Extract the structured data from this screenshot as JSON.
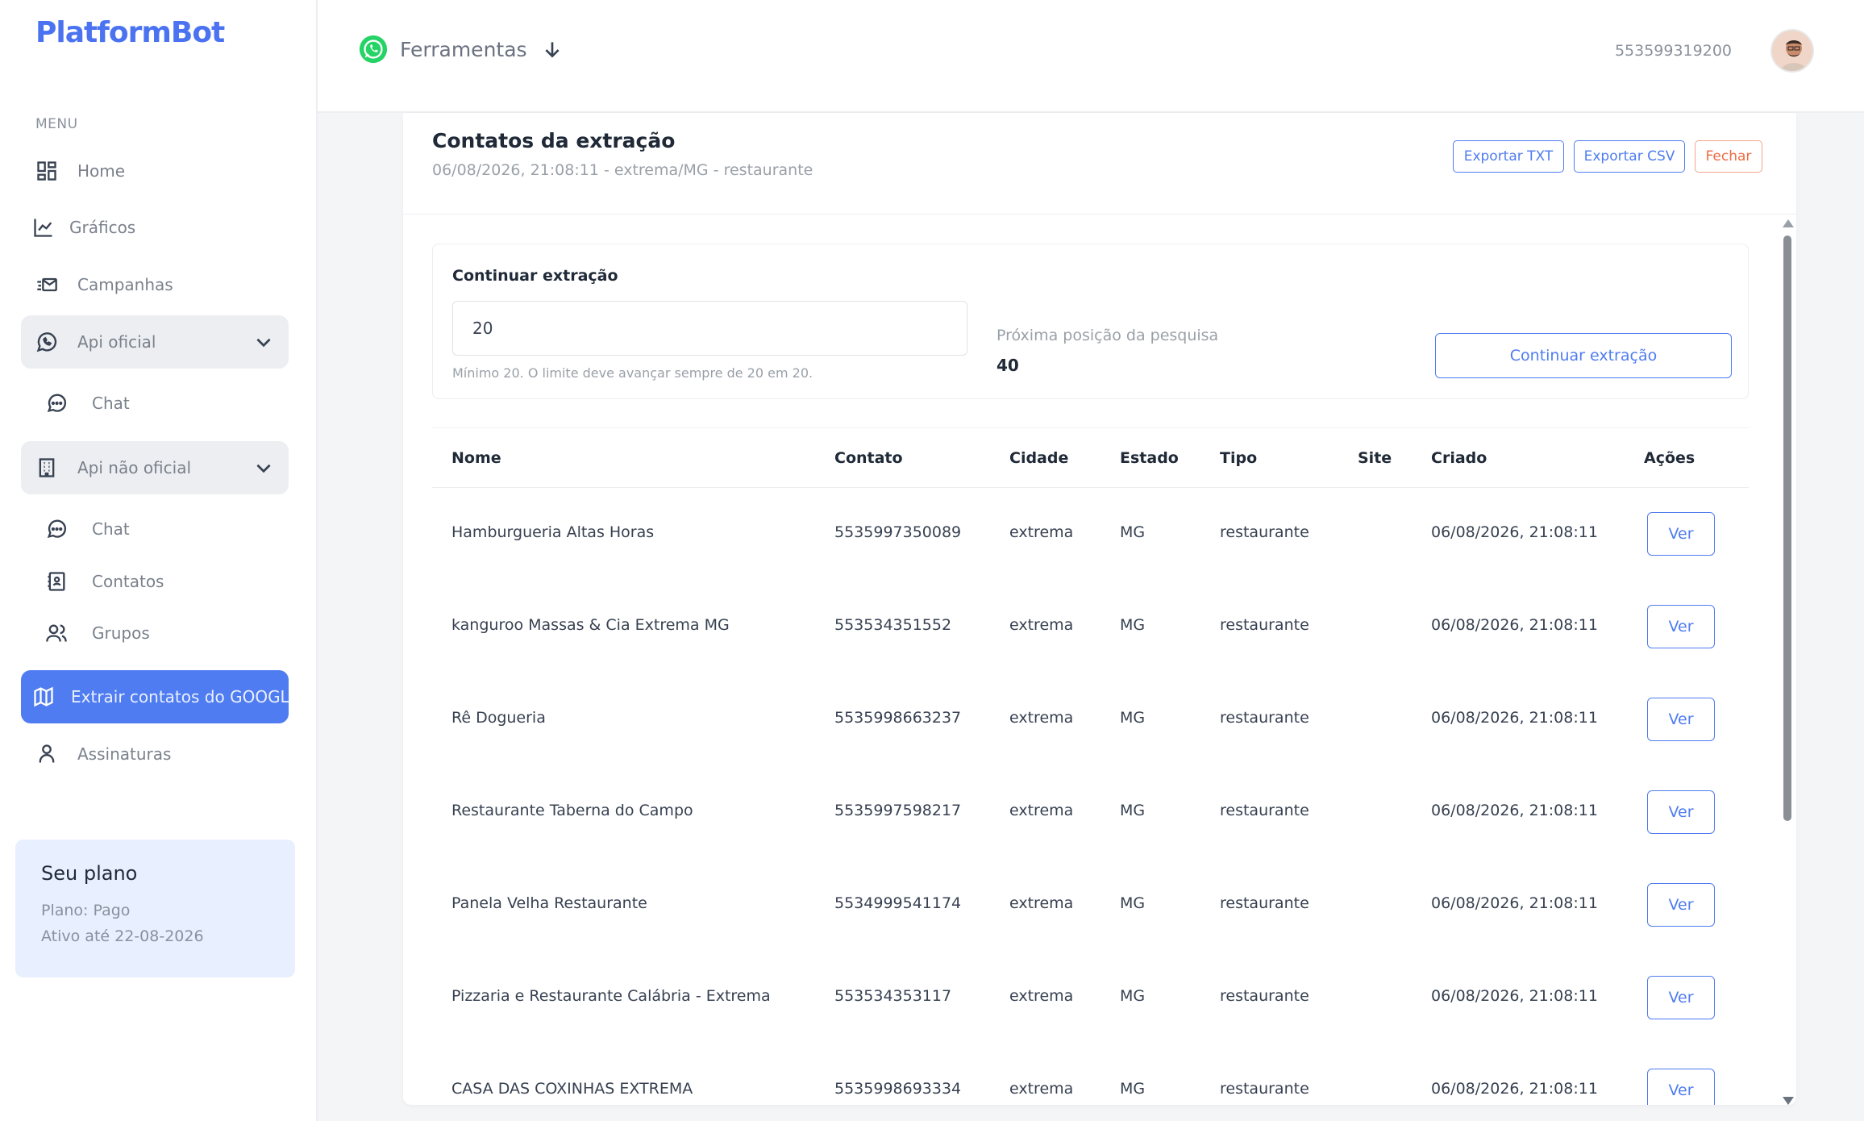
{
  "app": {
    "logo": "PlatformBot"
  },
  "sidebar": {
    "menu_label": "MENU",
    "items": [
      {
        "label": "Home",
        "icon": "dashboard-icon"
      },
      {
        "label": "Gráficos",
        "icon": "chart-icon"
      },
      {
        "label": "Campanhas",
        "icon": "campaign-mail-icon"
      },
      {
        "label": "Api oficial",
        "icon": "whatsapp-icon"
      },
      {
        "label": "Chat",
        "icon": "chat-bubble-icon"
      },
      {
        "label": "Api não oficial",
        "icon": "building-icon"
      },
      {
        "label": "Chat",
        "icon": "chat-bubble-icon"
      },
      {
        "label": "Contatos",
        "icon": "contacts-book-icon"
      },
      {
        "label": "Grupos",
        "icon": "users-icon"
      },
      {
        "label": "Extrair contatos do GOOGLE",
        "icon": "map-icon"
      },
      {
        "label": "Assinaturas",
        "icon": "user-icon"
      }
    ],
    "plan": {
      "title": "Seu plano",
      "plan_line": "Plano: Pago",
      "active_line": "Ativo até 22-08-2026"
    }
  },
  "topbar": {
    "tools_label": "Ferramentas",
    "phone": "553599319200"
  },
  "card": {
    "title": "Contatos da extração",
    "subtitle": "06/08/2026, 21:08:11 - extrema/MG - restaurante",
    "export_txt": "Exportar TXT",
    "export_csv": "Exportar CSV",
    "close": "Fechar"
  },
  "continue": {
    "label": "Continuar extração",
    "input_value": "20",
    "hint": "Mínimo 20. O limite deve avançar sempre de 20 em 20.",
    "next_label": "Próxima posição da pesquisa",
    "next_value": "40",
    "button": "Continuar extração"
  },
  "table": {
    "headers": [
      "Nome",
      "Contato",
      "Cidade",
      "Estado",
      "Tipo",
      "Site",
      "Criado",
      "Ações"
    ],
    "action_label": "Ver",
    "rows": [
      {
        "nome": "Hamburgueria Altas Horas",
        "contato": "5535997350089",
        "cidade": "extrema",
        "estado": "MG",
        "tipo": "restaurante",
        "site": "",
        "criado": "06/08/2026, 21:08:11"
      },
      {
        "nome": "kanguroo Massas & Cia Extrema MG",
        "contato": "553534351552",
        "cidade": "extrema",
        "estado": "MG",
        "tipo": "restaurante",
        "site": "",
        "criado": "06/08/2026, 21:08:11"
      },
      {
        "nome": "Rê Dogueria",
        "contato": "5535998663237",
        "cidade": "extrema",
        "estado": "MG",
        "tipo": "restaurante",
        "site": "",
        "criado": "06/08/2026, 21:08:11"
      },
      {
        "nome": "Restaurante Taberna do Campo",
        "contato": "5535997598217",
        "cidade": "extrema",
        "estado": "MG",
        "tipo": "restaurante",
        "site": "",
        "criado": "06/08/2026, 21:08:11"
      },
      {
        "nome": "Panela Velha Restaurante",
        "contato": "5534999541174",
        "cidade": "extrema",
        "estado": "MG",
        "tipo": "restaurante",
        "site": "",
        "criado": "06/08/2026, 21:08:11"
      },
      {
        "nome": "Pizzaria e Restaurante Calábria - Extrema",
        "contato": "553534353117",
        "cidade": "extrema",
        "estado": "MG",
        "tipo": "restaurante",
        "site": "",
        "criado": "06/08/2026, 21:08:11"
      },
      {
        "nome": "CASA DAS COXINHAS EXTREMA",
        "contato": "5535998693334",
        "cidade": "extrema",
        "estado": "MG",
        "tipo": "restaurante",
        "site": "",
        "criado": "06/08/2026, 21:08:11"
      }
    ]
  },
  "colors": {
    "accent": "#4f7cf0",
    "danger": "#ef6b43",
    "whatsapp": "#25d366"
  }
}
